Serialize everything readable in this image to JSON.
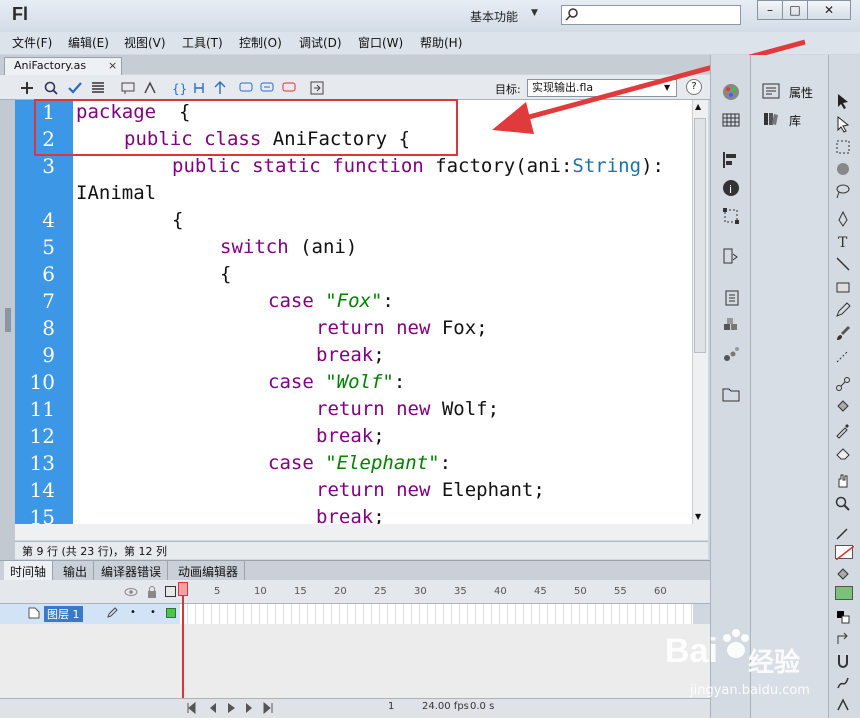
{
  "app": {
    "logo": "Fl",
    "workspace": "基本功能",
    "search_placeholder": ""
  },
  "window_buttons": {
    "minimize": "–",
    "maximize": "□",
    "close": "✕"
  },
  "menu": [
    "文件(F)",
    "编辑(E)",
    "视图(V)",
    "工具(T)",
    "控制(O)",
    "调试(D)",
    "窗口(W)",
    "帮助(H)"
  ],
  "document_tab": {
    "label": "AniFactory.as",
    "close": "×"
  },
  "toolbar": {
    "target_label": "目标:",
    "target_value": "实现输出.fla",
    "help": "?"
  },
  "code_lines": [
    {
      "n": "1",
      "indent": 0,
      "tokens": [
        [
          "kp",
          "package"
        ],
        [
          "",
          "  {"
        ]
      ]
    },
    {
      "n": "2",
      "indent": 4,
      "tokens": [
        [
          "kp",
          "public"
        ],
        [
          "",
          " "
        ],
        [
          "kp",
          "class"
        ],
        [
          "",
          " AniFactory {"
        ]
      ]
    },
    {
      "n": "3",
      "indent": 8,
      "tokens": [
        [
          "kp",
          "public"
        ],
        [
          "",
          " "
        ],
        [
          "kp",
          "static"
        ],
        [
          "",
          " "
        ],
        [
          "kp",
          "function"
        ],
        [
          "",
          " factory(ani:"
        ],
        [
          "ty",
          "String"
        ],
        [
          "",
          "):"
        ]
      ]
    },
    {
      "n": "",
      "indent": 0,
      "tokens": [
        [
          "",
          "IAnimal"
        ]
      ]
    },
    {
      "n": "4",
      "indent": 8,
      "tokens": [
        [
          "",
          "{"
        ]
      ]
    },
    {
      "n": "5",
      "indent": 12,
      "tokens": [
        [
          "kp",
          "switch"
        ],
        [
          "",
          " (ani)"
        ]
      ]
    },
    {
      "n": "6",
      "indent": 12,
      "tokens": [
        [
          "",
          "{"
        ]
      ]
    },
    {
      "n": "7",
      "indent": 16,
      "tokens": [
        [
          "kp",
          "case"
        ],
        [
          "",
          " "
        ],
        [
          "str",
          "\"Fox\""
        ],
        [
          "",
          ":"
        ]
      ]
    },
    {
      "n": "8",
      "indent": 20,
      "tokens": [
        [
          "kp",
          "return"
        ],
        [
          "",
          " "
        ],
        [
          "kp",
          "new"
        ],
        [
          "",
          " Fox;"
        ]
      ]
    },
    {
      "n": "9",
      "indent": 20,
      "tokens": [
        [
          "kp",
          "break"
        ],
        [
          "",
          ";"
        ]
      ]
    },
    {
      "n": "10",
      "indent": 16,
      "tokens": [
        [
          "kp",
          "case"
        ],
        [
          "",
          " "
        ],
        [
          "str",
          "\"Wolf\""
        ],
        [
          "",
          ":"
        ]
      ]
    },
    {
      "n": "11",
      "indent": 20,
      "tokens": [
        [
          "kp",
          "return"
        ],
        [
          "",
          " "
        ],
        [
          "kp",
          "new"
        ],
        [
          "",
          " Wolf;"
        ]
      ]
    },
    {
      "n": "12",
      "indent": 20,
      "tokens": [
        [
          "kp",
          "break"
        ],
        [
          "",
          ";"
        ]
      ]
    },
    {
      "n": "13",
      "indent": 16,
      "tokens": [
        [
          "kp",
          "case"
        ],
        [
          "",
          " "
        ],
        [
          "str",
          "\"Elephant\""
        ],
        [
          "",
          ":"
        ]
      ]
    },
    {
      "n": "14",
      "indent": 20,
      "tokens": [
        [
          "kp",
          "return"
        ],
        [
          "",
          " "
        ],
        [
          "kp",
          "new"
        ],
        [
          "",
          " Elephant;"
        ]
      ]
    },
    {
      "n": "15",
      "indent": 20,
      "tokens": [
        [
          "kp",
          "break"
        ],
        [
          "",
          ";"
        ]
      ]
    }
  ],
  "status": "第 9 行 (共 23 行)，第 12 列",
  "bottom_tabs": [
    "时间轴",
    "输出",
    "编译器错误",
    "动画编辑器"
  ],
  "timeline": {
    "layer_name": "图层 1",
    "ticks": [
      "1",
      "5",
      "10",
      "15",
      "20",
      "25",
      "30",
      "35",
      "40",
      "45",
      "50",
      "55",
      "60"
    ],
    "frame": "1",
    "fps": "24.00 fps",
    "time": "0.0 s"
  },
  "panels": {
    "properties": "属性",
    "library": "库"
  },
  "colors": {
    "gutter": "#3c98e7",
    "keyword": "#800080",
    "string": "#008000",
    "annotation": "#d9383a",
    "fill": "#7bc17b"
  },
  "watermark": {
    "brand": "Bai",
    "brand2": "经验",
    "url": "jingyan.baidu.com"
  }
}
